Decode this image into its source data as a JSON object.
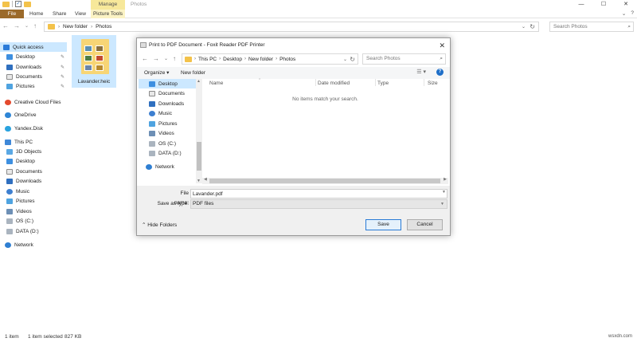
{
  "explorer": {
    "title": "Photos",
    "manage_tab": "Manage",
    "ribbon_tabs": [
      "File",
      "Home",
      "Share",
      "View",
      "Picture Tools"
    ],
    "address": {
      "parts": [
        "New folder",
        "Photos"
      ]
    },
    "search_placeholder": "Search Photos",
    "nav": [
      {
        "label": "Quick access",
        "icon": "star-icon",
        "pinned": false
      },
      {
        "label": "Desktop",
        "icon": "desktop-icon",
        "pinned": true
      },
      {
        "label": "Downloads",
        "icon": "downloads-icon",
        "pinned": true
      },
      {
        "label": "Documents",
        "icon": "documents-icon",
        "pinned": true
      },
      {
        "label": "Pictures",
        "icon": "pictures-icon",
        "pinned": true
      },
      {
        "label": "Creative Cloud Files",
        "icon": "creative-cloud-icon",
        "pinned": false
      },
      {
        "label": "OneDrive",
        "icon": "onedrive-icon",
        "pinned": false
      },
      {
        "label": "Yandex.Disk",
        "icon": "yandex-disk-icon",
        "pinned": false
      },
      {
        "label": "This PC",
        "icon": "this-pc-icon",
        "pinned": false
      },
      {
        "label": "3D Objects",
        "icon": "3d-objects-icon",
        "pinned": false
      },
      {
        "label": "Desktop",
        "icon": "desktop-icon",
        "pinned": false
      },
      {
        "label": "Documents",
        "icon": "documents-icon",
        "pinned": false
      },
      {
        "label": "Downloads",
        "icon": "downloads-icon",
        "pinned": false
      },
      {
        "label": "Music",
        "icon": "music-icon",
        "pinned": false
      },
      {
        "label": "Pictures",
        "icon": "pictures-icon",
        "pinned": false
      },
      {
        "label": "Videos",
        "icon": "videos-icon",
        "pinned": false
      },
      {
        "label": "OS (C:)",
        "icon": "drive-icon",
        "pinned": false
      },
      {
        "label": "DATA (D:)",
        "icon": "drive-icon",
        "pinned": false
      },
      {
        "label": "Network",
        "icon": "network-icon",
        "pinned": false
      }
    ],
    "file": {
      "name": "Lavander.heic"
    },
    "status": {
      "count": "1 item",
      "selected": "1 item selected",
      "size": "827 KB"
    }
  },
  "dialog": {
    "title": "Print to PDF Document - Foxit Reader PDF Printer",
    "address": {
      "parts": [
        "This PC",
        "Desktop",
        "New folder",
        "Photos"
      ]
    },
    "search_placeholder": "Search Photos",
    "organize": "Organize",
    "new_folder": "New folder",
    "nav": [
      {
        "label": "Desktop",
        "icon": "desktop-icon"
      },
      {
        "label": "Documents",
        "icon": "documents-icon"
      },
      {
        "label": "Downloads",
        "icon": "downloads-icon"
      },
      {
        "label": "Music",
        "icon": "music-icon"
      },
      {
        "label": "Pictures",
        "icon": "pictures-icon"
      },
      {
        "label": "Videos",
        "icon": "videos-icon"
      },
      {
        "label": "OS (C:)",
        "icon": "drive-icon"
      },
      {
        "label": "DATA (D:)",
        "icon": "drive-icon"
      },
      {
        "label": "Network",
        "icon": "network-icon"
      }
    ],
    "columns": [
      "Name",
      "Date modified",
      "Type",
      "Size"
    ],
    "empty_message": "No items match your search.",
    "file_name_label": "File name:",
    "file_name_value": "Lavander.pdf",
    "save_type_label": "Save as type:",
    "save_type_value": "PDF files",
    "hide_folders": "Hide Folders",
    "save": "Save",
    "cancel": "Cancel"
  },
  "watermark": "wsxdn.com"
}
